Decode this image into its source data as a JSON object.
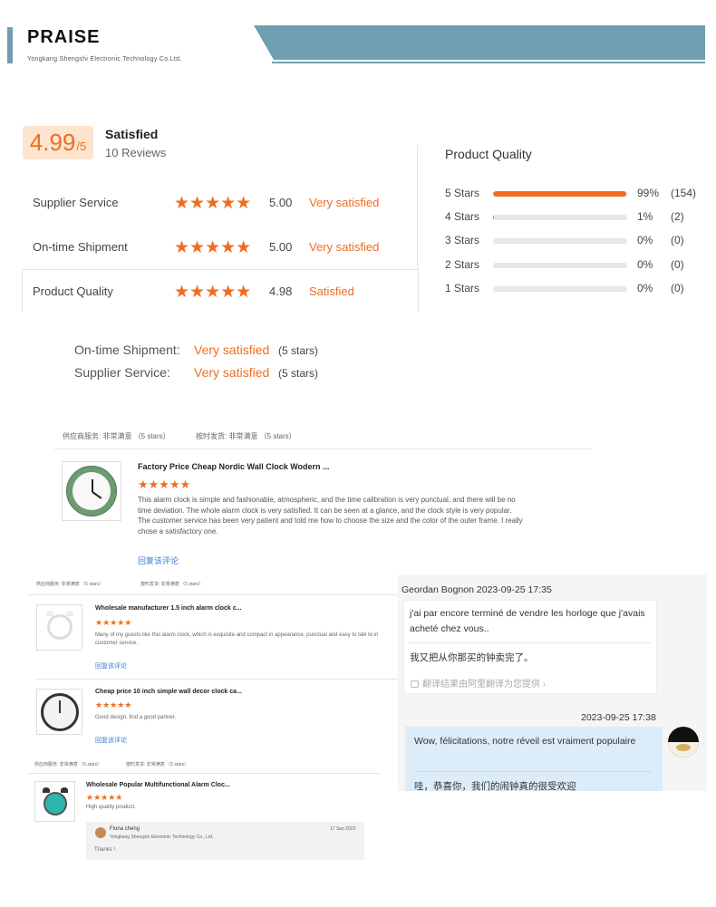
{
  "header": {
    "title": "PRAISE",
    "subtitle": "Yongkang Shengshi Electronic Technology Co.Ltd."
  },
  "summary": {
    "score": "4.99",
    "score_suffix": "/5",
    "satisfaction": "Satisfied",
    "reviews": "10 Reviews",
    "rows": [
      {
        "label": "Supplier Service",
        "stars": "★★★★★",
        "value": "5.00",
        "text": "Very satisfied"
      },
      {
        "label": "On-time Shipment",
        "stars": "★★★★★",
        "value": "5.00",
        "text": "Very satisfied"
      },
      {
        "label": "Product Quality",
        "stars": "★★★★★",
        "value": "4.98",
        "text": "Satisfied"
      }
    ]
  },
  "product_quality": {
    "title": "Product Quality",
    "bars": [
      {
        "label": "5  Stars",
        "fraction": 0.99,
        "pct": "99%",
        "count": "(154)"
      },
      {
        "label": "4  Stars",
        "fraction": 0.01,
        "pct": "1%",
        "count": "(2)"
      },
      {
        "label": "3  Stars",
        "fraction": 0,
        "pct": "0%",
        "count": "(0)"
      },
      {
        "label": "2  Stars",
        "fraction": 0,
        "pct": "0%",
        "count": "(0)"
      },
      {
        "label": "1  Stars",
        "fraction": 0,
        "pct": "0%",
        "count": "(0)"
      }
    ]
  },
  "shipment": [
    {
      "label": "On-time Shipment:",
      "value": "Very satisfied",
      "stars": "(5 stars)"
    },
    {
      "label": "Supplier Service:",
      "value": "Very satisfied",
      "stars": "(5 stars)"
    }
  ],
  "review1": {
    "head_supplier": "供应商服务: 非常满意 （5 stars）",
    "head_shipping": "按时发货: 非常满意 （5 stars）",
    "title": "Factory Price Cheap Nordic Wall Clock Wodern ...",
    "stars": "★★★★★",
    "text": "This alarm clock is simple and fashionable, atmospheric, and the time calibration is very punctual, and there will be no time deviation. The whole alarm clock is very satisfied. It can be seen at a glance, and the clock style is very popular. The customer service has been very patient and told me how to choose the size and the color of the outer frame. I really chose a satisfactory one.",
    "reply": "回复该评论"
  },
  "review2": {
    "head_supplier": "供应商服务: 非常满意 （5 stars）",
    "head_shipping": "按时发货: 非常满意 （5 stars）",
    "items": [
      {
        "title": "Wholesale manufacturer 1.5 inch alarm clock c...",
        "stars": "★★★★★",
        "text": "Many of my guests like this alarm clock, which is exquisite and compact in appearance, punctual and easy to talk to in customer service.",
        "reply": "回复该评论"
      },
      {
        "title": "Cheap price 10 inch simple wall decor clock ca...",
        "stars": "★★★★★",
        "text": "Good design, find a good partner.",
        "reply": "回复该评论"
      }
    ]
  },
  "review3": {
    "head_supplier": "供应商服务: 非常满意 （5 stars）",
    "head_shipping": "按时发货: 非常满意 （5 stars）",
    "title": "Wholesale Popular Multifunctional Alarm Cloc...",
    "stars": "★★★★★",
    "text": "High quality product.",
    "reply_name": "Fiona cheng",
    "reply_company": "Yongkang Shengshi Electronic Technology Co., Ltd.",
    "reply_date": "17 Sep 2023",
    "reply_text": "Thanks !"
  },
  "chat": {
    "sender": "Geordan Bognon  2023-09-25 17:35",
    "msg1": "j'ai par encore terminé de vendre les horloge que j'avais acheté chez vous..",
    "msg1_translation": "我又把从你那买的钟卖完了。",
    "translate_note": "翻译结果由阿里翻译为您提供",
    "reply_time": "2023-09-25 17:38",
    "msg2": "Wow, félicitations, notre réveil est vraiment populaire",
    "msg2_translation": "哇，恭喜你，我们的闹钟真的很受欢迎"
  },
  "colors": {
    "accent": "#f06d1f",
    "banner": "#6f9fb0",
    "link": "#3a7bd5"
  }
}
